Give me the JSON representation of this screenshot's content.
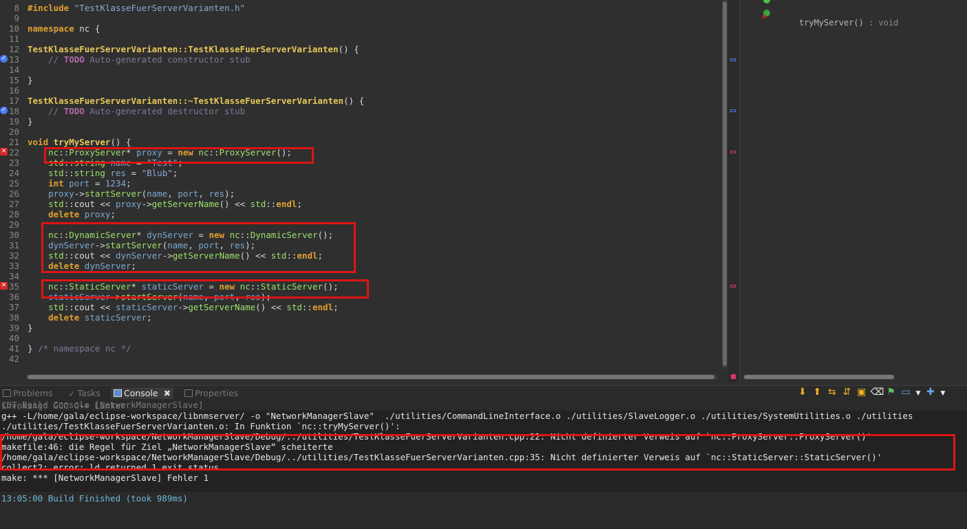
{
  "editor": {
    "lines": [
      {
        "n": "8",
        "mark": "",
        "parts": [
          [
            "inc",
            "#include "
          ],
          [
            "str",
            "\"TestKlasseFuerServerVarianten.h\""
          ]
        ]
      },
      {
        "n": "9",
        "mark": "",
        "parts": []
      },
      {
        "n": "10",
        "mark": "fold",
        "parts": [
          [
            "kw",
            "namespace "
          ],
          [
            "pl",
            "nc {"
          ]
        ]
      },
      {
        "n": "11",
        "mark": "",
        "parts": []
      },
      {
        "n": "12",
        "mark": "fold",
        "parts": [
          [
            "fn",
            "TestKlasseFuerServerVarianten::TestKlasseFuerServerVarianten"
          ],
          [
            "pl",
            "() {"
          ]
        ]
      },
      {
        "n": "13",
        "mark": "bm",
        "parts": [
          [
            "cmt",
            "    // "
          ],
          [
            "todo",
            "TODO"
          ],
          [
            "cmt",
            " Auto-generated constructor stub"
          ]
        ]
      },
      {
        "n": "14",
        "mark": "",
        "parts": []
      },
      {
        "n": "15",
        "mark": "",
        "parts": [
          [
            "pl",
            "}"
          ]
        ]
      },
      {
        "n": "16",
        "mark": "",
        "parts": []
      },
      {
        "n": "17",
        "mark": "fold",
        "parts": [
          [
            "fn",
            "TestKlasseFuerServerVarianten::~TestKlasseFuerServerVarianten"
          ],
          [
            "pl",
            "() {"
          ]
        ]
      },
      {
        "n": "18",
        "mark": "bm",
        "parts": [
          [
            "cmt",
            "    // "
          ],
          [
            "todo",
            "TODO"
          ],
          [
            "cmt",
            " Auto-generated destructor stub"
          ]
        ]
      },
      {
        "n": "19",
        "mark": "",
        "parts": [
          [
            "pl",
            "}"
          ]
        ]
      },
      {
        "n": "20",
        "mark": "",
        "parts": []
      },
      {
        "n": "21",
        "mark": "fold",
        "parts": [
          [
            "kw",
            "void "
          ],
          [
            "fn",
            "tryMyServer"
          ],
          [
            "pl",
            "() {"
          ]
        ]
      },
      {
        "n": "22",
        "mark": "err",
        "parts": [
          [
            "pl",
            "    "
          ],
          [
            "ns",
            "nc"
          ],
          [
            "pl",
            "::"
          ],
          [
            "ty",
            "ProxyServer"
          ],
          [
            "pl",
            "* "
          ],
          [
            "var",
            "proxy"
          ],
          [
            "pl",
            " = "
          ],
          [
            "kw",
            "new "
          ],
          [
            "ns",
            "nc"
          ],
          [
            "pl",
            "::"
          ],
          [
            "ty",
            "ProxyServer"
          ],
          [
            "pl",
            "();"
          ]
        ]
      },
      {
        "n": "23",
        "mark": "",
        "parts": [
          [
            "pl",
            "    "
          ],
          [
            "ns",
            "std"
          ],
          [
            "pl",
            "::"
          ],
          [
            "ty",
            "string "
          ],
          [
            "var",
            "name"
          ],
          [
            "pl",
            " = "
          ],
          [
            "str",
            "\"Test\""
          ],
          [
            "pl",
            ";"
          ]
        ]
      },
      {
        "n": "24",
        "mark": "",
        "parts": [
          [
            "pl",
            "    "
          ],
          [
            "ns",
            "std"
          ],
          [
            "pl",
            "::"
          ],
          [
            "ty",
            "string "
          ],
          [
            "var",
            "res"
          ],
          [
            "pl",
            " = "
          ],
          [
            "str",
            "\"Blub\""
          ],
          [
            "pl",
            ";"
          ]
        ]
      },
      {
        "n": "25",
        "mark": "",
        "parts": [
          [
            "pl",
            "    "
          ],
          [
            "kw",
            "int "
          ],
          [
            "var",
            "port"
          ],
          [
            "pl",
            " = "
          ],
          [
            "num",
            "1234"
          ],
          [
            "pl",
            ";"
          ]
        ]
      },
      {
        "n": "26",
        "mark": "",
        "parts": [
          [
            "pl",
            "    "
          ],
          [
            "var",
            "proxy"
          ],
          [
            "pl",
            "->"
          ],
          [
            "meth",
            "startServer"
          ],
          [
            "pl",
            "("
          ],
          [
            "var",
            "name"
          ],
          [
            "pl",
            ", "
          ],
          [
            "var",
            "port"
          ],
          [
            "pl",
            ", "
          ],
          [
            "var",
            "res"
          ],
          [
            "pl",
            ");"
          ]
        ]
      },
      {
        "n": "27",
        "mark": "",
        "parts": [
          [
            "pl",
            "    "
          ],
          [
            "ns",
            "std"
          ],
          [
            "pl",
            "::cout << "
          ],
          [
            "var",
            "proxy"
          ],
          [
            "pl",
            "->"
          ],
          [
            "meth",
            "getServerName"
          ],
          [
            "pl",
            "() << "
          ],
          [
            "ns",
            "std"
          ],
          [
            "pl",
            "::"
          ],
          [
            "kw",
            "endl"
          ],
          [
            "pl",
            ";"
          ]
        ]
      },
      {
        "n": "28",
        "mark": "",
        "parts": [
          [
            "pl",
            "    "
          ],
          [
            "kw",
            "delete "
          ],
          [
            "var",
            "proxy"
          ],
          [
            "pl",
            ";"
          ]
        ]
      },
      {
        "n": "29",
        "mark": "",
        "parts": []
      },
      {
        "n": "30",
        "mark": "",
        "parts": [
          [
            "pl",
            "    "
          ],
          [
            "ns",
            "nc"
          ],
          [
            "pl",
            "::"
          ],
          [
            "ty",
            "DynamicServer"
          ],
          [
            "pl",
            "* "
          ],
          [
            "var",
            "dynServer"
          ],
          [
            "pl",
            " = "
          ],
          [
            "kw",
            "new "
          ],
          [
            "ns",
            "nc"
          ],
          [
            "pl",
            "::"
          ],
          [
            "ty",
            "DynamicServer"
          ],
          [
            "pl",
            "();"
          ]
        ]
      },
      {
        "n": "31",
        "mark": "",
        "parts": [
          [
            "pl",
            "    "
          ],
          [
            "var",
            "dynServer"
          ],
          [
            "pl",
            "->"
          ],
          [
            "meth",
            "startServer"
          ],
          [
            "pl",
            "("
          ],
          [
            "var",
            "name"
          ],
          [
            "pl",
            ", "
          ],
          [
            "var",
            "port"
          ],
          [
            "pl",
            ", "
          ],
          [
            "var",
            "res"
          ],
          [
            "pl",
            ");"
          ]
        ]
      },
      {
        "n": "32",
        "mark": "",
        "parts": [
          [
            "pl",
            "    "
          ],
          [
            "ns",
            "std"
          ],
          [
            "pl",
            "::cout << "
          ],
          [
            "var",
            "dynServer"
          ],
          [
            "pl",
            "->"
          ],
          [
            "meth",
            "getServerName"
          ],
          [
            "pl",
            "() << "
          ],
          [
            "ns",
            "std"
          ],
          [
            "pl",
            "::"
          ],
          [
            "kw",
            "endl"
          ],
          [
            "pl",
            ";"
          ]
        ]
      },
      {
        "n": "33",
        "mark": "",
        "parts": [
          [
            "pl",
            "    "
          ],
          [
            "kw",
            "delete "
          ],
          [
            "var",
            "dynServer"
          ],
          [
            "pl",
            ";"
          ]
        ]
      },
      {
        "n": "34",
        "mark": "",
        "parts": []
      },
      {
        "n": "35",
        "mark": "err",
        "parts": [
          [
            "pl",
            "    "
          ],
          [
            "ns",
            "nc"
          ],
          [
            "pl",
            "::"
          ],
          [
            "ty",
            "StaticServer"
          ],
          [
            "pl",
            "* "
          ],
          [
            "var",
            "staticServer"
          ],
          [
            "pl",
            " = "
          ],
          [
            "kw",
            "new "
          ],
          [
            "ns",
            "nc"
          ],
          [
            "pl",
            "::"
          ],
          [
            "ty",
            "StaticServer"
          ],
          [
            "pl",
            "();"
          ]
        ]
      },
      {
        "n": "36",
        "mark": "",
        "parts": [
          [
            "pl",
            "    "
          ],
          [
            "var",
            "staticServer"
          ],
          [
            "pl",
            "->"
          ],
          [
            "meth",
            "startServer"
          ],
          [
            "pl",
            "("
          ],
          [
            "var",
            "name"
          ],
          [
            "pl",
            ", "
          ],
          [
            "var",
            "port"
          ],
          [
            "pl",
            ", "
          ],
          [
            "var",
            "res"
          ],
          [
            "pl",
            ");"
          ]
        ]
      },
      {
        "n": "37",
        "mark": "",
        "parts": [
          [
            "pl",
            "    "
          ],
          [
            "ns",
            "std"
          ],
          [
            "pl",
            "::cout << "
          ],
          [
            "var",
            "staticServer"
          ],
          [
            "pl",
            "->"
          ],
          [
            "meth",
            "getServerName"
          ],
          [
            "pl",
            "() << "
          ],
          [
            "ns",
            "std"
          ],
          [
            "pl",
            "::"
          ],
          [
            "kw",
            "endl"
          ],
          [
            "pl",
            ";"
          ]
        ]
      },
      {
        "n": "38",
        "mark": "",
        "parts": [
          [
            "pl",
            "    "
          ],
          [
            "kw",
            "delete "
          ],
          [
            "var",
            "staticServer"
          ],
          [
            "pl",
            ";"
          ]
        ]
      },
      {
        "n": "39",
        "mark": "",
        "parts": [
          [
            "pl",
            "}"
          ]
        ]
      },
      {
        "n": "40",
        "mark": "",
        "parts": []
      },
      {
        "n": "41",
        "mark": "",
        "parts": [
          [
            "pl",
            "} "
          ],
          [
            "cmt",
            "/* namespace nc */"
          ]
        ]
      },
      {
        "n": "42",
        "mark": "",
        "parts": []
      }
    ]
  },
  "outline": {
    "item_name": "tryMyServer()",
    "item_type": " : void"
  },
  "bottom_tabs": [
    {
      "label": "Problems",
      "active": false
    },
    {
      "label": "Tasks",
      "active": false
    },
    {
      "label": "Console",
      "active": true
    },
    {
      "label": "Properties",
      "active": false
    }
  ],
  "console": {
    "title": "CDT Build Console [NetworkManagerSlave]",
    "lines": [
      "invoking: GCC C++ Linker",
      "g++ -L/home/gala/eclipse-workspace/libnmserver/ -o \"NetworkManagerSlave\"  ./utilities/CommandLineInterface.o ./utilities/SlaveLogger.o ./utilities/SystemUtilities.o ./utilities",
      "./utilities/TestKlasseFuerServerVarianten.o: In Funktion `nc::tryMyServer()':",
      "/home/gala/eclipse-workspace/NetworkManagerSlave/Debug/../utilities/TestKlasseFuerServerVarianten.cpp:22: Nicht definierter Verweis auf `nc::ProxyServer::ProxyServer()'",
      "makefile:46: die Regel für Ziel „NetworkManagerSlave“ scheiterte",
      "/home/gala/eclipse-workspace/NetworkManagerSlave/Debug/../utilities/TestKlasseFuerServerVarianten.cpp:35: Nicht definierter Verweis auf `nc::StaticServer::StaticServer()'",
      "collect2: error: ld returned 1 exit status",
      "make: *** [NetworkManagerSlave] Fehler 1",
      "",
      "13:05:00 Build Finished (took 989ms)"
    ]
  }
}
